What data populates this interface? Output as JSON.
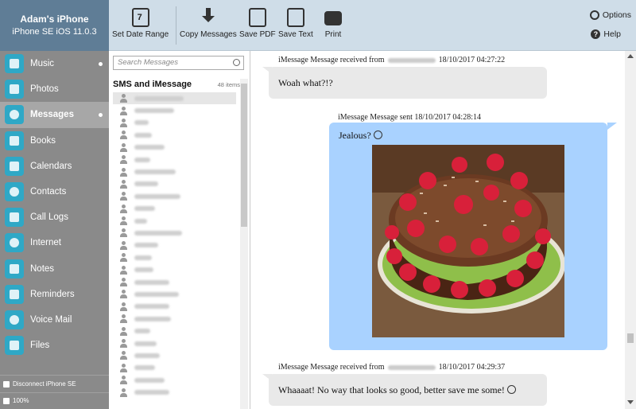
{
  "device": {
    "name": "Adam's iPhone",
    "model": "iPhone SE iOS 11.0.3"
  },
  "nav": [
    {
      "label": "Music",
      "icon": "music-icon",
      "dot": true
    },
    {
      "label": "Photos",
      "icon": "photos-icon",
      "dot": false
    },
    {
      "label": "Messages",
      "icon": "messages-icon",
      "dot": true,
      "active": true
    },
    {
      "label": "Books",
      "icon": "books-icon",
      "dot": false
    },
    {
      "label": "Calendars",
      "icon": "calendar-icon",
      "dot": false
    },
    {
      "label": "Contacts",
      "icon": "contacts-icon",
      "dot": false
    },
    {
      "label": "Call Logs",
      "icon": "phone-icon",
      "dot": false
    },
    {
      "label": "Internet",
      "icon": "internet-icon",
      "dot": false
    },
    {
      "label": "Notes",
      "icon": "notes-icon",
      "dot": false
    },
    {
      "label": "Reminders",
      "icon": "reminders-icon",
      "dot": false
    },
    {
      "label": "Voice Mail",
      "icon": "voicemail-icon",
      "dot": false
    },
    {
      "label": "Files",
      "icon": "files-icon",
      "dot": false
    }
  ],
  "sidebar_footer": {
    "disconnect": "Disconnect iPhone SE",
    "battery": "100%"
  },
  "toolbar": {
    "date_range": {
      "label": "Set Date Range",
      "day": "7"
    },
    "copy_messages": "Copy Messages",
    "save_pdf": "Save PDF",
    "save_text": "Save Text",
    "print": "Print",
    "options": "Options",
    "help": "Help"
  },
  "search": {
    "placeholder": "Search Messages"
  },
  "list": {
    "title": "SMS and iMessage",
    "count": "48 items"
  },
  "messages": [
    {
      "meta_prefix": "iMessage Message received from",
      "meta_time": "18/10/2017 04:27:22",
      "text": "Woah what?!?"
    },
    {
      "meta": "iMessage Message sent 18/10/2017 04:28:14",
      "text": "Jealous?"
    },
    {
      "meta_prefix": "iMessage Message received from",
      "meta_time": "18/10/2017 04:29:37",
      "text": "Whaaaat! No way that looks so good, better save me some!"
    }
  ],
  "colors": {
    "sidebar": "#8a8a8a",
    "toolbar": "#cfdde8",
    "incoming": "#e9e9e9",
    "outgoing": "#a9d2ff",
    "nav_icon": "#2fa8c6"
  }
}
